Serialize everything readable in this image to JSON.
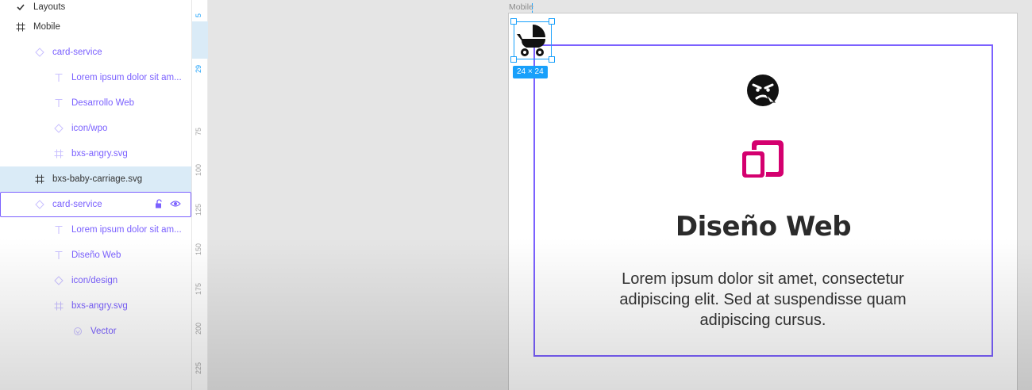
{
  "layers": {
    "items": [
      {
        "label": "Layouts",
        "icon": "check-icon",
        "indent": 18
      },
      {
        "label": "Mobile",
        "icon": "frame-icon",
        "indent": 18
      },
      {
        "label": "card-service",
        "icon": "component-instance-icon",
        "indent": 42
      },
      {
        "label": "Lorem ipsum dolor sit am...",
        "icon": "text-icon",
        "indent": 66
      },
      {
        "label": "Desarrollo Web",
        "icon": "text-icon",
        "indent": 66
      },
      {
        "label": "icon/wpo",
        "icon": "component-instance-icon",
        "indent": 66
      },
      {
        "label": "bxs-angry.svg",
        "icon": "frame-icon",
        "indent": 66
      },
      {
        "label": "bxs-baby-carriage.svg",
        "icon": "frame-icon",
        "indent": 42
      },
      {
        "label": "card-service",
        "icon": "component-instance-icon",
        "indent": 42
      },
      {
        "label": "Lorem ipsum dolor sit am...",
        "icon": "text-icon",
        "indent": 66
      },
      {
        "label": "Diseño Web",
        "icon": "text-icon",
        "indent": 66
      },
      {
        "label": "icon/design",
        "icon": "component-instance-icon",
        "indent": 66
      },
      {
        "label": "bxs-angry.svg",
        "icon": "frame-icon",
        "indent": 66
      },
      {
        "label": "Vector",
        "icon": "vector-icon",
        "indent": 90
      }
    ]
  },
  "ruler": {
    "ticks": [
      "5",
      "29",
      "75",
      "100",
      "125",
      "150",
      "175",
      "200",
      "225"
    ]
  },
  "canvas": {
    "frame_label": "Mobile",
    "selection_size": "24 × 24",
    "card": {
      "title": "Diseño Web",
      "text": "Lorem ipsum dolor sit amet, consectetur adipiscing elit. Sed at suspendisse quam adipiscing cursus."
    }
  },
  "colors": {
    "accent": "#7b61ff",
    "selection": "#18a0fb",
    "design_icon": "#d4006f"
  }
}
